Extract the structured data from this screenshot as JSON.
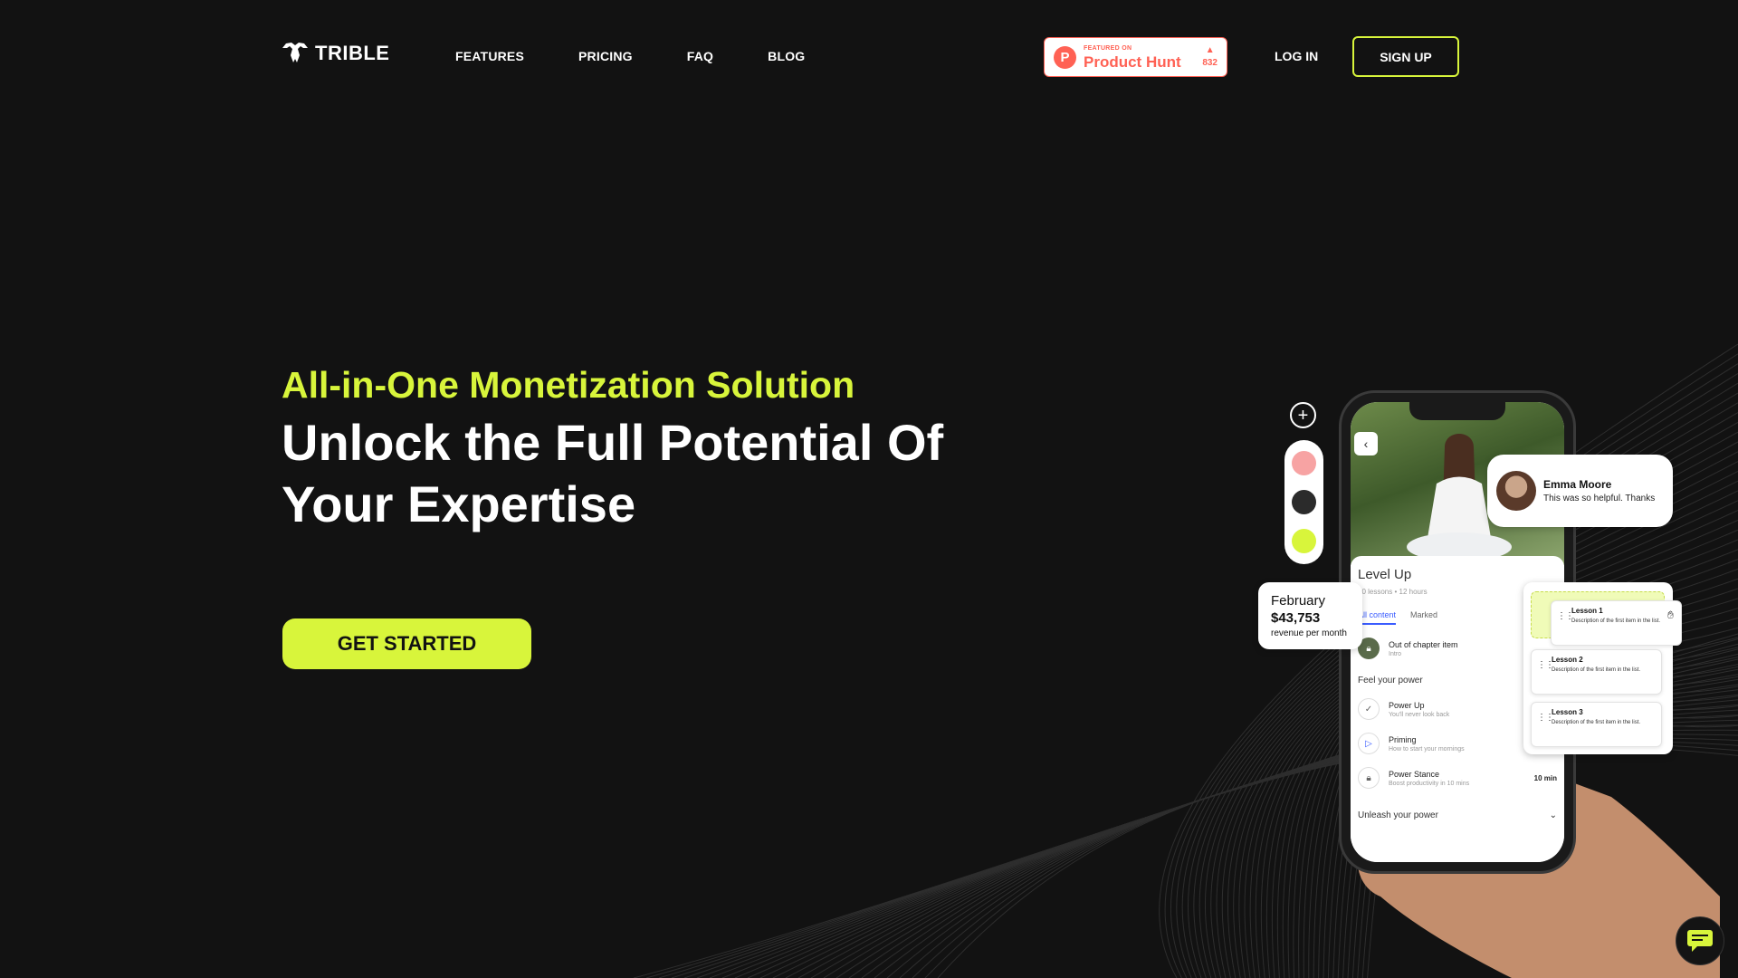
{
  "header": {
    "brand": "TRIBLE",
    "nav": [
      "FEATURES",
      "PRICING",
      "FAQ",
      "BLOG"
    ],
    "product_hunt": {
      "featured": "FEATURED ON",
      "name": "Product Hunt",
      "votes": "832"
    },
    "login_label": "LOG IN",
    "signup_label": "SIGN UP"
  },
  "hero": {
    "kicker": "All-in-One Monetization Solution",
    "headline": "Unlock the Full Potential Of Your Expertise",
    "cta_label": "GET STARTED"
  },
  "mockup": {
    "comment": {
      "name": "Emma Moore",
      "text": "This was so helpful. Thanks"
    },
    "revenue": {
      "month": "February",
      "amount": "$43,753",
      "label": "revenue per month"
    },
    "course": {
      "title": "Level Up",
      "meta": "10 lessons • 12 hours",
      "tabs": [
        "All content",
        "Marked"
      ],
      "intro_item": {
        "title": "Out of chapter item",
        "sub": "Intro"
      },
      "section1": "Feel your power",
      "items": [
        {
          "title": "Power Up",
          "sub": "You'll never look back",
          "icon": "check-icon",
          "extra": ""
        },
        {
          "title": "Priming",
          "sub": "How to start your mornings",
          "icon": "play-icon",
          "extra": ""
        },
        {
          "title": "Power Stance",
          "sub": "Boost productivity in 10 mins",
          "icon": "lock-icon",
          "extra": "10 min"
        }
      ],
      "section2": "Unleash your power"
    },
    "lessons": [
      {
        "title": "Lesson 1",
        "desc": "Description of the first item in the list."
      },
      {
        "title": "Lesson 2",
        "desc": "Description of the first item in the list."
      },
      {
        "title": "Lesson 3",
        "desc": "Description of the first item in the list."
      }
    ],
    "swatch_colors": [
      "#f7a3a3",
      "#2b2b2b",
      "#d8f53b"
    ]
  },
  "colors": {
    "background": "#121212",
    "accent": "#d8f53b",
    "product_hunt": "#ff6154"
  }
}
